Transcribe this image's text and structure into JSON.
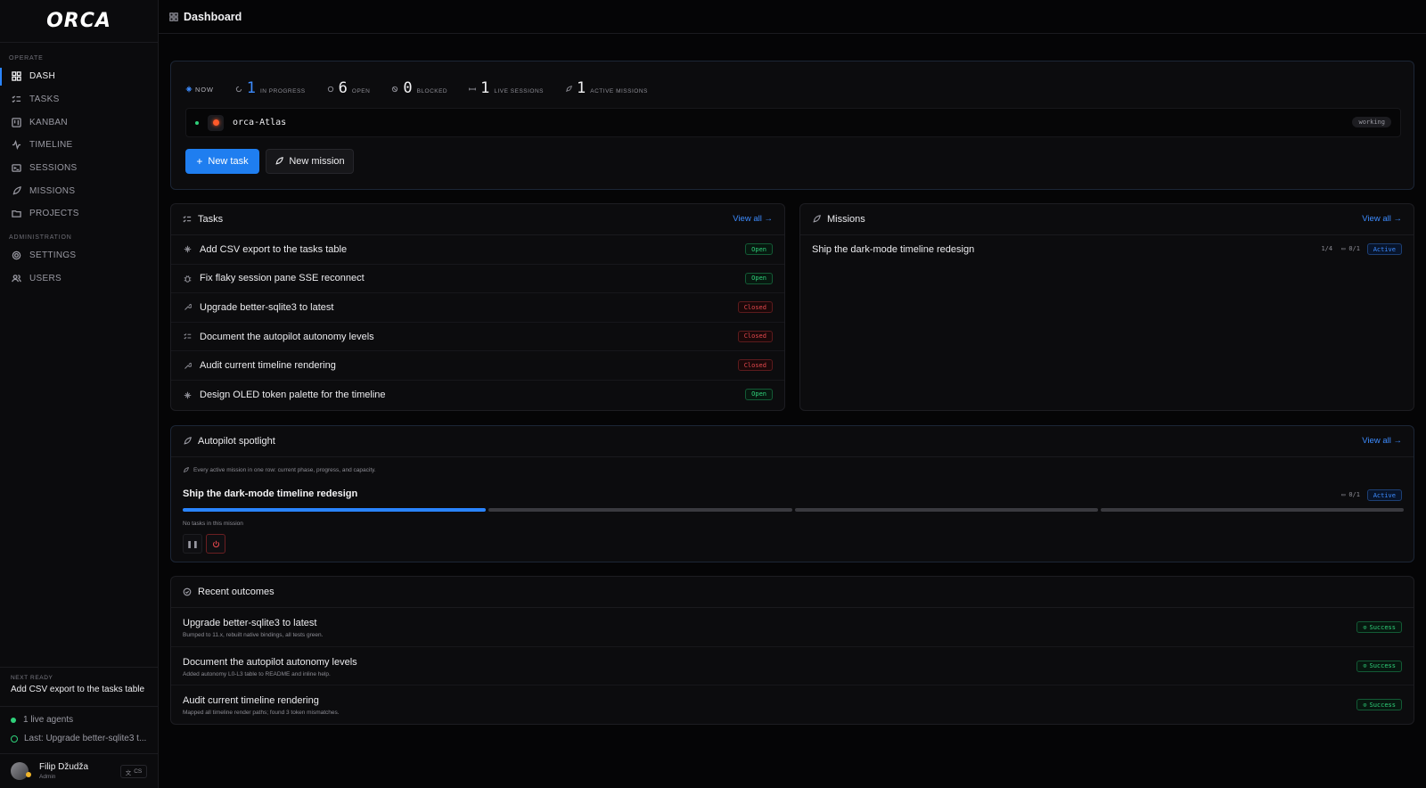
{
  "app": {
    "logo": "ORCA"
  },
  "sidebar": {
    "sections": [
      {
        "label": "OPERATE",
        "items": [
          {
            "label": "DASH",
            "icon": "grid-icon",
            "active": true
          },
          {
            "label": "TASKS",
            "icon": "list-check-icon"
          },
          {
            "label": "KANBAN",
            "icon": "kanban-icon"
          },
          {
            "label": "TIMELINE",
            "icon": "pulse-icon"
          },
          {
            "label": "SESSIONS",
            "icon": "terminal-icon"
          },
          {
            "label": "MISSIONS",
            "icon": "rocket-icon"
          },
          {
            "label": "PROJECTS",
            "icon": "folder-icon"
          }
        ]
      },
      {
        "label": "ADMINISTRATION",
        "items": [
          {
            "label": "SETTINGS",
            "icon": "gear-icon"
          },
          {
            "label": "USERS",
            "icon": "users-icon"
          }
        ]
      }
    ],
    "next_ready": {
      "label": "NEXT READY",
      "title": "Add CSV export to the tasks table"
    },
    "live_agents": "1 live agents",
    "last": "Last: Upgrade better-sqlite3 t...",
    "user": {
      "name": "Filip Džudža",
      "role": "Admin",
      "lang": "CS"
    }
  },
  "header": {
    "title": "Dashboard"
  },
  "now": {
    "label": "NOW",
    "stats": [
      {
        "value": "1",
        "label": "IN PROGRESS"
      },
      {
        "value": "6",
        "label": "OPEN"
      },
      {
        "value": "0",
        "label": "BLOCKED"
      },
      {
        "value": "1",
        "label": "LIVE SESSIONS"
      },
      {
        "value": "1",
        "label": "ACTIVE MISSIONS"
      }
    ],
    "agent": {
      "name": "orca-Atlas",
      "status": "working"
    },
    "new_task": "New task",
    "new_mission": "New mission"
  },
  "tasks": {
    "title": "Tasks",
    "view_all": "View all",
    "items": [
      {
        "title": "Add CSV export to the tasks table",
        "status": "Open"
      },
      {
        "title": "Fix flaky session pane SSE reconnect",
        "status": "Open"
      },
      {
        "title": "Upgrade better-sqlite3 to latest",
        "status": "Closed"
      },
      {
        "title": "Document the autopilot autonomy levels",
        "status": "Closed"
      },
      {
        "title": "Audit current timeline rendering",
        "status": "Closed"
      },
      {
        "title": "Design OLED token palette for the timeline",
        "status": "Open"
      }
    ]
  },
  "missions": {
    "title": "Missions",
    "view_all": "View all",
    "items": [
      {
        "title": "Ship the dark-mode timeline redesign",
        "phase": "1/4",
        "sessions": "0/1",
        "status": "Active"
      }
    ]
  },
  "autopilot": {
    "title": "Autopilot spotlight",
    "view_all": "View all",
    "description": "Every active mission in one row: current phase, progress, and capacity.",
    "mission": {
      "title": "Ship the dark-mode timeline redesign",
      "sessions": "0/1",
      "status": "Active",
      "phases_total": 4,
      "phases_done": 1
    },
    "empty": "No tasks in this mission"
  },
  "outcomes": {
    "title": "Recent outcomes",
    "items": [
      {
        "title": "Upgrade better-sqlite3 to latest",
        "detail": "Bumped to 11.x, rebuilt native bindings, all tests green.",
        "status": "Success"
      },
      {
        "title": "Document the autopilot autonomy levels",
        "detail": "Added autonomy L0-L3 table to README and inline help.",
        "status": "Success"
      },
      {
        "title": "Audit current timeline rendering",
        "detail": "Mapped all timeline render paths; found 3 token mismatches.",
        "status": "Success"
      }
    ]
  },
  "colors": {
    "accent": "#1f7ef0",
    "success": "#2fd07a",
    "danger": "#e5484d",
    "bg": "#050506"
  }
}
